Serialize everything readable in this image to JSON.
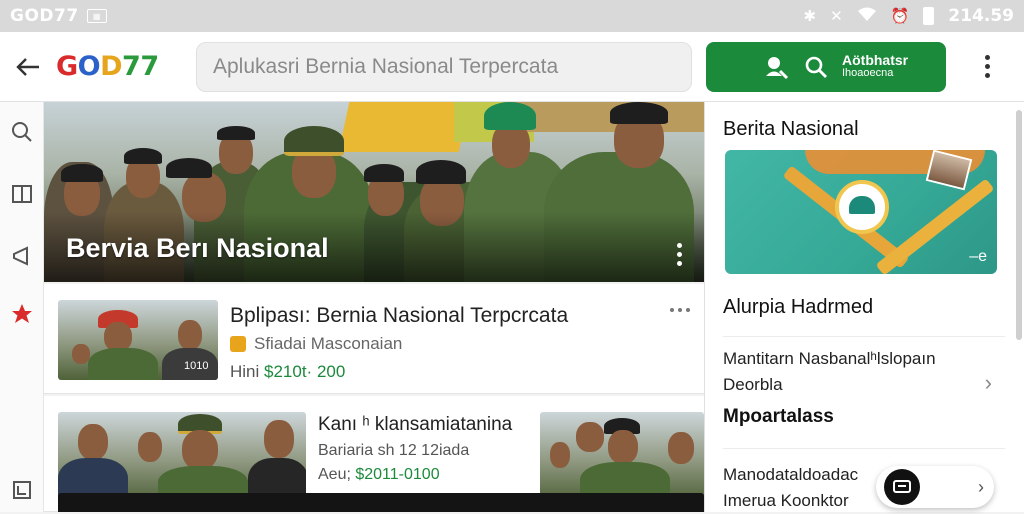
{
  "status_bar": {
    "app_name": "GOD77",
    "time": "214.59",
    "icons": [
      "bluetooth-icon",
      "mute-icon",
      "wifi-icon",
      "alarm-icon",
      "battery-icon"
    ]
  },
  "app_bar": {
    "logo": {
      "g": "G",
      "o": "O",
      "d": "D",
      "n": "77"
    },
    "search_value": "Aplukasri  Bernia Nasional Terpercata",
    "action_button": {
      "line1": "Aötbhatsr",
      "line2": "Ihoaoecna"
    }
  },
  "hero": {
    "title": "Bervia Berı Nasional"
  },
  "cards": [
    {
      "title": "Bplipası: Bernia Nasional Terpcrcata",
      "subtitle": "Sfiadai Masconaian",
      "price_prefix": "Hini ",
      "price": "$210t· 200",
      "thumb_caption": "1010"
    },
    {
      "title": "Kanı ʰ klansamiatanina",
      "subtitle": "Bariaria sh 12 12iada",
      "price_prefix": "Aeu; ",
      "price": "$2011-0100"
    }
  ],
  "right_panel": {
    "heading": "Berita Nasional",
    "banner_tag": "–e",
    "item1": "Alurpia Hadrmed",
    "item2_line1": "Mantitarn Nasbanalʰlslopaın",
    "item2_line2": "Deorbla",
    "item3": "Mpoartalass",
    "item4_line1": "Manodataldoadac",
    "item4_line2": "Imerua Koonktor"
  },
  "colors": {
    "accent_green": "#1c8a3b",
    "status_bar": "#d9d9d9",
    "banner_teal": "#43b7a6"
  }
}
